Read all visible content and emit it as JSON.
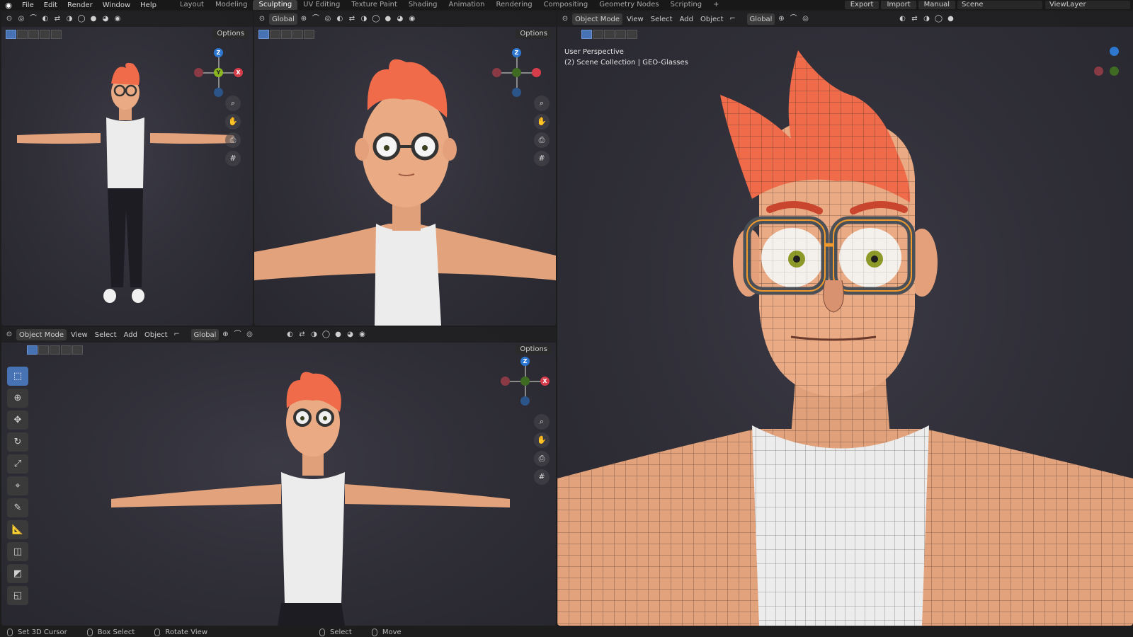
{
  "menu": [
    "File",
    "Edit",
    "Render",
    "Window",
    "Help"
  ],
  "workspaces": [
    "Layout",
    "Modeling",
    "Sculpting",
    "UV Editing",
    "Texture Paint",
    "Shading",
    "Animation",
    "Rendering",
    "Compositing",
    "Geometry Nodes",
    "Scripting"
  ],
  "active_workspace": "Sculpting",
  "add_workspace": "+",
  "top_right": {
    "export": "Export",
    "import": "Import",
    "manual": "Manual",
    "scene": "Scene",
    "view_layer": "ViewLayer"
  },
  "header": {
    "mode": "Object Mode",
    "view": "View",
    "select": "Select",
    "add": "Add",
    "object": "Object",
    "orientation": "Global",
    "options": "Options"
  },
  "overlay_text": {
    "perspective": "User Perspective",
    "collection": "(2) Scene Collection | GEO-Glasses"
  },
  "gizmo_labels": {
    "x": "X",
    "y": "Y",
    "z": "Z"
  },
  "icons": {
    "blender": "blender-logo-icon",
    "zoom": "zoom-icon",
    "pan": "hand-icon",
    "camera": "camera-icon",
    "grid": "grid-icon"
  },
  "tools": [
    "select-box",
    "cursor",
    "move",
    "rotate",
    "scale",
    "transform",
    "annotate",
    "measure",
    "add-cube",
    "extrude",
    "shear"
  ],
  "status": [
    "Set 3D Cursor",
    "Box Select",
    "Rotate View",
    "Select",
    "Move"
  ],
  "colors": {
    "accent": "#4772b3",
    "axis_x": "#d63d4b",
    "axis_y": "#8ab61e",
    "axis_z": "#2e77d0",
    "skin": "#e8a87c",
    "hair": "#ef6b4a",
    "tank": "#e8e8e8",
    "glasses": "#f39a2c"
  }
}
